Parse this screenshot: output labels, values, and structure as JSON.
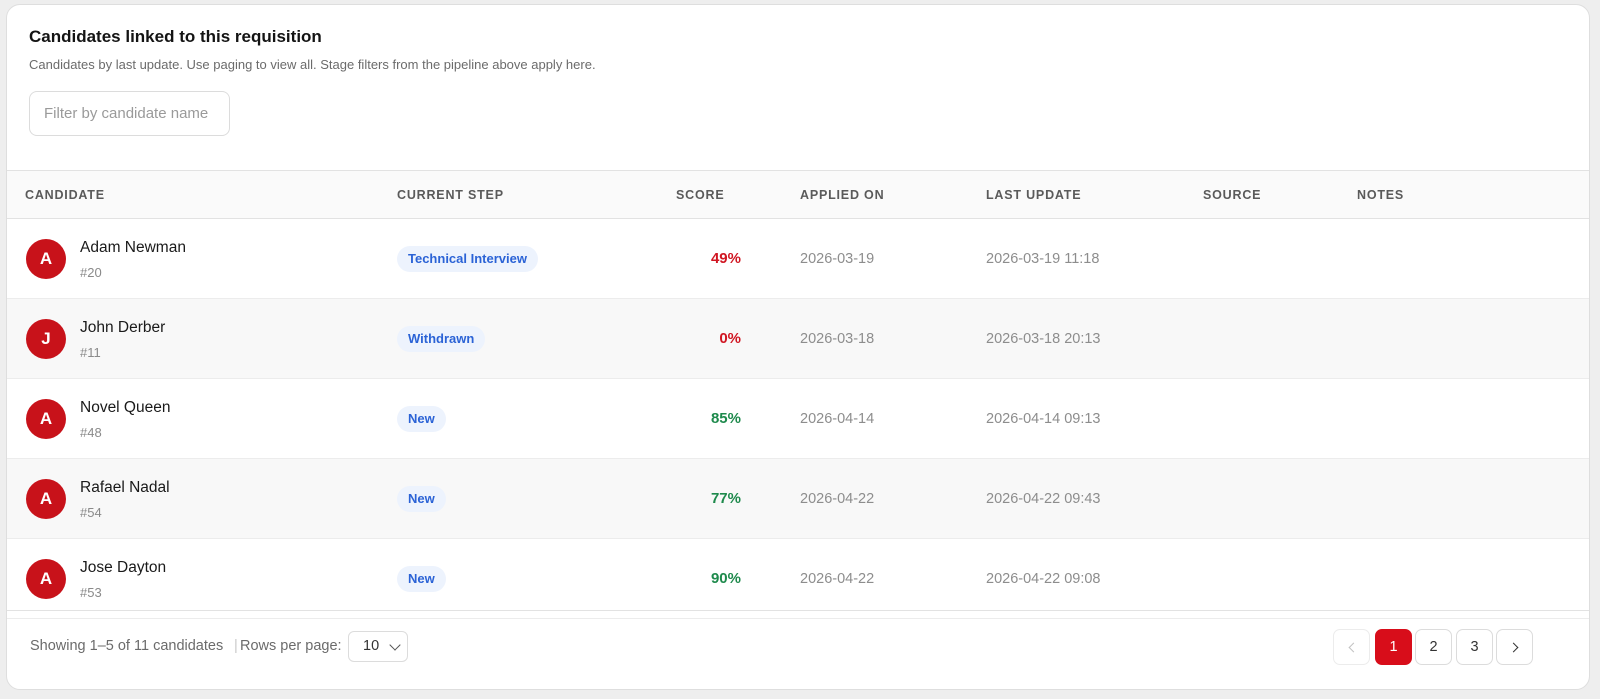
{
  "header": {
    "title": "Candidates linked to this requisition",
    "subtitle": "Candidates by last update. Use paging to view all. Stage filters from the pipeline above apply here.",
    "filter_placeholder": "Filter by candidate name",
    "filter_value": ""
  },
  "table": {
    "columns": [
      "CANDIDATE",
      "CURRENT STEP",
      "SCORE",
      "APPLIED ON",
      "LAST UPDATE",
      "SOURCE",
      "NOTES"
    ],
    "rows": [
      {
        "initial": "A",
        "name": "Adam Newman",
        "id": "#20",
        "step": "Technical Interview",
        "score": "49%",
        "score_level": "low",
        "applied": "2026-03-19",
        "last_update": "2026-03-19 11:18",
        "source": "",
        "notes": ""
      },
      {
        "initial": "J",
        "name": "John Derber",
        "id": "#11",
        "step": "Withdrawn",
        "score": "0%",
        "score_level": "low",
        "applied": "2026-03-18",
        "last_update": "2026-03-18 20:13",
        "source": "",
        "notes": ""
      },
      {
        "initial": "A",
        "name": "Novel Queen",
        "id": "#48",
        "step": "New",
        "score": "85%",
        "score_level": "high",
        "applied": "2026-04-14",
        "last_update": "2026-04-14 09:13",
        "source": "",
        "notes": ""
      },
      {
        "initial": "A",
        "name": "Rafael Nadal",
        "id": "#54",
        "step": "New",
        "score": "77%",
        "score_level": "high",
        "applied": "2026-04-22",
        "last_update": "2026-04-22 09:43",
        "source": "",
        "notes": ""
      },
      {
        "initial": "A",
        "name": "Jose Dayton",
        "id": "#53",
        "step": "New",
        "score": "90%",
        "score_level": "high",
        "applied": "2026-04-22",
        "last_update": "2026-04-22 09:08",
        "source": "",
        "notes": ""
      }
    ]
  },
  "footer": {
    "showing": "Showing 1–5 of 11 candidates",
    "separator": "|",
    "rows_per_page_label": "Rows per page:",
    "rows_per_page_value": "10",
    "pages": [
      "1",
      "2",
      "3"
    ],
    "current_page": "1"
  },
  "colors": {
    "accent": "#d80d1a",
    "avatar": "#c8121a",
    "score_low": "#d01622",
    "score_high": "#1e8a4c",
    "pill_bg": "#edf3fd",
    "pill_text": "#2b63d6"
  },
  "icons": {
    "prev": "chevron-left-icon",
    "next": "chevron-right-icon",
    "select": "chevron-down-icon"
  }
}
